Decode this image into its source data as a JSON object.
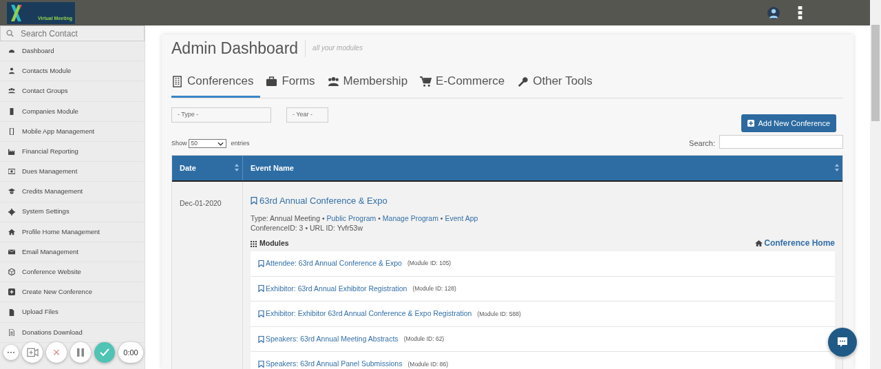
{
  "header": {
    "logo_text": "Virtual Meeting"
  },
  "sidebar": {
    "search": {
      "placeholder": "Search Contact"
    },
    "items": [
      {
        "label": "Dashboard"
      },
      {
        "label": "Contacts Module"
      },
      {
        "label": "Contact Groups"
      },
      {
        "label": "Companies Module"
      },
      {
        "label": "Mobile App Management"
      },
      {
        "label": "Financial Reporting"
      },
      {
        "label": "Dues Management"
      },
      {
        "label": "Credits Management"
      },
      {
        "label": "System Settings"
      },
      {
        "label": "Profile Home Management"
      },
      {
        "label": "Email Management"
      },
      {
        "label": "Conference Website"
      },
      {
        "label": "Create New Conference"
      },
      {
        "label": "Upload Files"
      },
      {
        "label": "Donations Download"
      }
    ]
  },
  "page": {
    "title": "Admin Dashboard",
    "subtitle": "all your modules",
    "tabs": [
      {
        "label": "Conferences",
        "selected": true
      },
      {
        "label": "Forms",
        "selected": false
      },
      {
        "label": "Membership",
        "selected": false
      },
      {
        "label": "E-Commerce",
        "selected": false
      },
      {
        "label": "Other Tools",
        "selected": false
      }
    ],
    "filters": [
      {
        "value": "- Type -"
      },
      {
        "value": "- Year -"
      }
    ],
    "add_button": "Add New Conference",
    "show_label": "Show",
    "entries_value": "50",
    "entries_label": "entries",
    "search_label": "Search:"
  },
  "table": {
    "columns": [
      "Date",
      "Event Name"
    ],
    "rows": [
      {
        "date": "Dec-01-2020",
        "title": "63rd Annual Conference & Expo",
        "type_text": "Type: Annual Meeting",
        "separator": "•",
        "links": [
          "Public Program",
          "Manage Program",
          "Event App"
        ],
        "id_line": "ConferenceID: 3 • URL ID: Yvfr53w",
        "modules_heading": "Modules",
        "home_link": "Conference Home",
        "modules": [
          {
            "name": "Attendee: 63rd Annual Conference & Expo",
            "id": "(Module ID: 105)"
          },
          {
            "name": "Exhibitor: 63rd Annual Exhibitor Registration",
            "id": "(Module ID: 128)"
          },
          {
            "name": "Exhibitor: Exhibitor 63rd Annual Conference & Expo Registration",
            "id": "(Module ID: 588)"
          },
          {
            "name": "Speakers: 63rd Annual Meeting Abstracts",
            "id": "(Module ID: 62)"
          },
          {
            "name": "Speakers: 63rd Annual Panel Submissions",
            "id": "(Module ID: 86)"
          }
        ]
      }
    ]
  },
  "recorder": {
    "more": "⋯",
    "close": "×",
    "time": "0:00"
  }
}
